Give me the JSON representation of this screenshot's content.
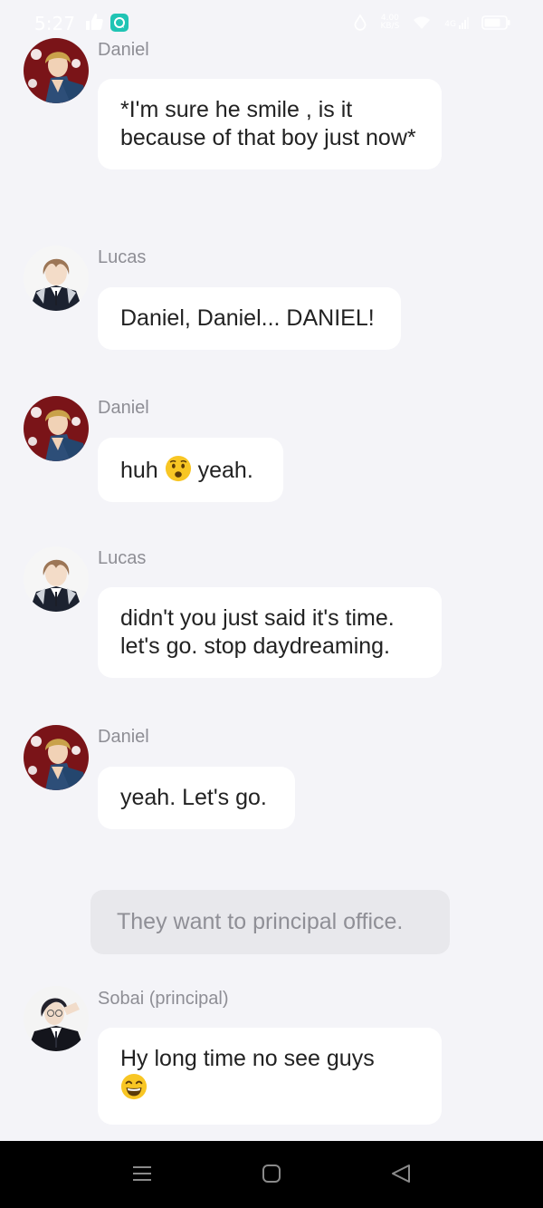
{
  "status_bar": {
    "time": "5:27",
    "data_rate_value": "4.00",
    "data_rate_unit": "KB/S",
    "network_type": "4G",
    "colors": {
      "text": "#ffffff",
      "chat_app_icon": "#20c4b4"
    }
  },
  "chat": {
    "messages": [
      {
        "sender": "Daniel",
        "text": "*I'm sure he smile , is it because of that boy just now*"
      },
      {
        "sender": "Lucas",
        "text": "Daniel, Daniel... DANIEL!"
      },
      {
        "sender": "Daniel",
        "text_before": "huh",
        "emoji": "anxious-face-emoji",
        "text_after": "yeah."
      },
      {
        "sender": "Lucas",
        "line1": "didn't you just said it's time.",
        "line2": "let's go. stop daydreaming."
      },
      {
        "sender": "Daniel",
        "text": "yeah. Let's go."
      }
    ],
    "narration": "They want to principal office.",
    "last_message": {
      "sender": "Sobai (principal)",
      "text": "Hy long time no see guys",
      "emoji": "grinning-face-emoji"
    }
  },
  "colors": {
    "background": "#f4f4f8",
    "bubble": "#ffffff",
    "narration_bubble": "#e8e8ec",
    "sender_name": "#8e8e95",
    "message_text": "#222222",
    "nav_bar": "#000000"
  },
  "nav_bar": {
    "icons": [
      "menu-icon",
      "home-icon",
      "back-icon"
    ]
  }
}
